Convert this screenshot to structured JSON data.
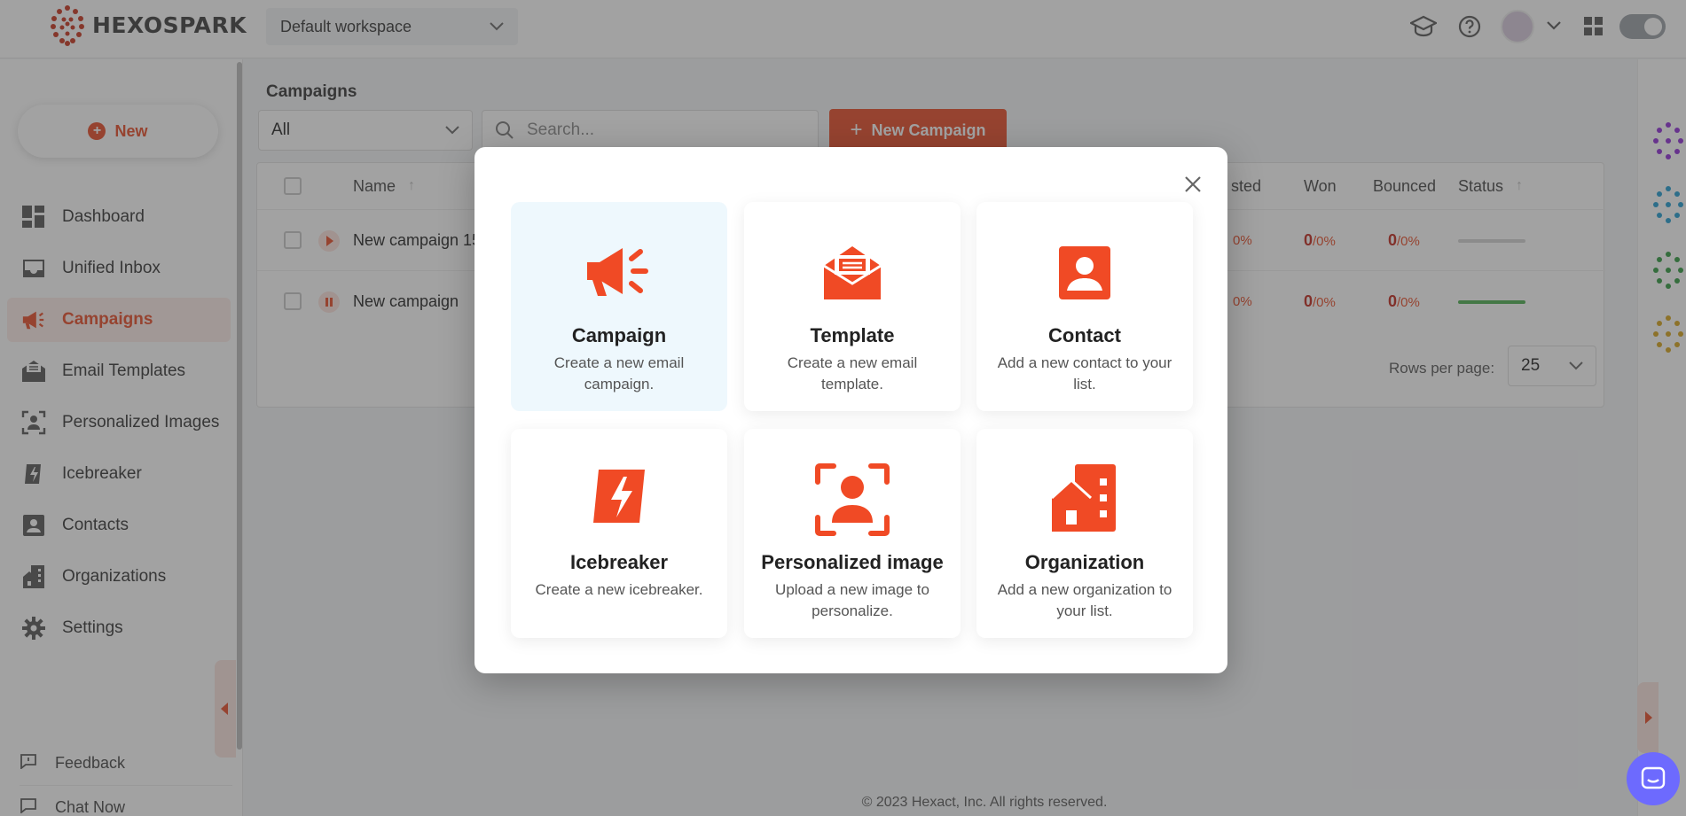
{
  "brand": {
    "name": "HEXOSPARK"
  },
  "workspace": {
    "selected": "Default workspace"
  },
  "sidebar": {
    "new_label": "New",
    "items": [
      {
        "label": "Dashboard"
      },
      {
        "label": "Unified Inbox"
      },
      {
        "label": "Campaigns",
        "active": true
      },
      {
        "label": "Email Templates"
      },
      {
        "label": "Personalized Images"
      },
      {
        "label": "Icebreaker"
      },
      {
        "label": "Contacts"
      },
      {
        "label": "Organizations"
      },
      {
        "label": "Settings"
      }
    ],
    "bottom": [
      {
        "label": "Feedback"
      },
      {
        "label": "Chat Now"
      }
    ]
  },
  "main": {
    "title": "Campaigns",
    "filter_value": "All",
    "search_placeholder": "Search...",
    "new_campaign_label": "New Campaign",
    "columns": {
      "name": "Name",
      "listed": "sted",
      "won": "Won",
      "bounced": "Bounced",
      "status": "Status"
    },
    "rows": [
      {
        "name": "New campaign 15",
        "listed": "0%",
        "won_n": "0",
        "won_p": "/0%",
        "bounced_n": "0",
        "bounced_p": "/0%",
        "state": "play"
      },
      {
        "name": "New campaign",
        "listed": "0%",
        "won_n": "0",
        "won_p": "/0%",
        "bounced_n": "0",
        "bounced_p": "/0%",
        "state": "pause"
      }
    ],
    "rows_per_page_label": "Rows per page:",
    "rows_per_page": "25",
    "footer": "© 2023 Hexact, Inc. All rights reserved."
  },
  "modal": {
    "cards": [
      {
        "title": "Campaign",
        "desc": "Create a new email campaign.",
        "icon": "megaphone-icon"
      },
      {
        "title": "Template",
        "desc": "Create a new email template.",
        "icon": "envelope-open-icon"
      },
      {
        "title": "Contact",
        "desc": "Add a new contact to your list.",
        "icon": "contact-card-icon"
      },
      {
        "title": "Icebreaker",
        "desc": "Create a new icebreaker.",
        "icon": "lightning-icon"
      },
      {
        "title": "Personalized image",
        "desc": "Upload a new image to personalize.",
        "icon": "person-frame-icon"
      },
      {
        "title": "Organization",
        "desc": "Add a new organization to your list.",
        "icon": "building-icon"
      }
    ]
  },
  "colors": {
    "accent": "#e84a25",
    "highlight_card": "#eef8fd",
    "chat": "#6d6afe"
  }
}
